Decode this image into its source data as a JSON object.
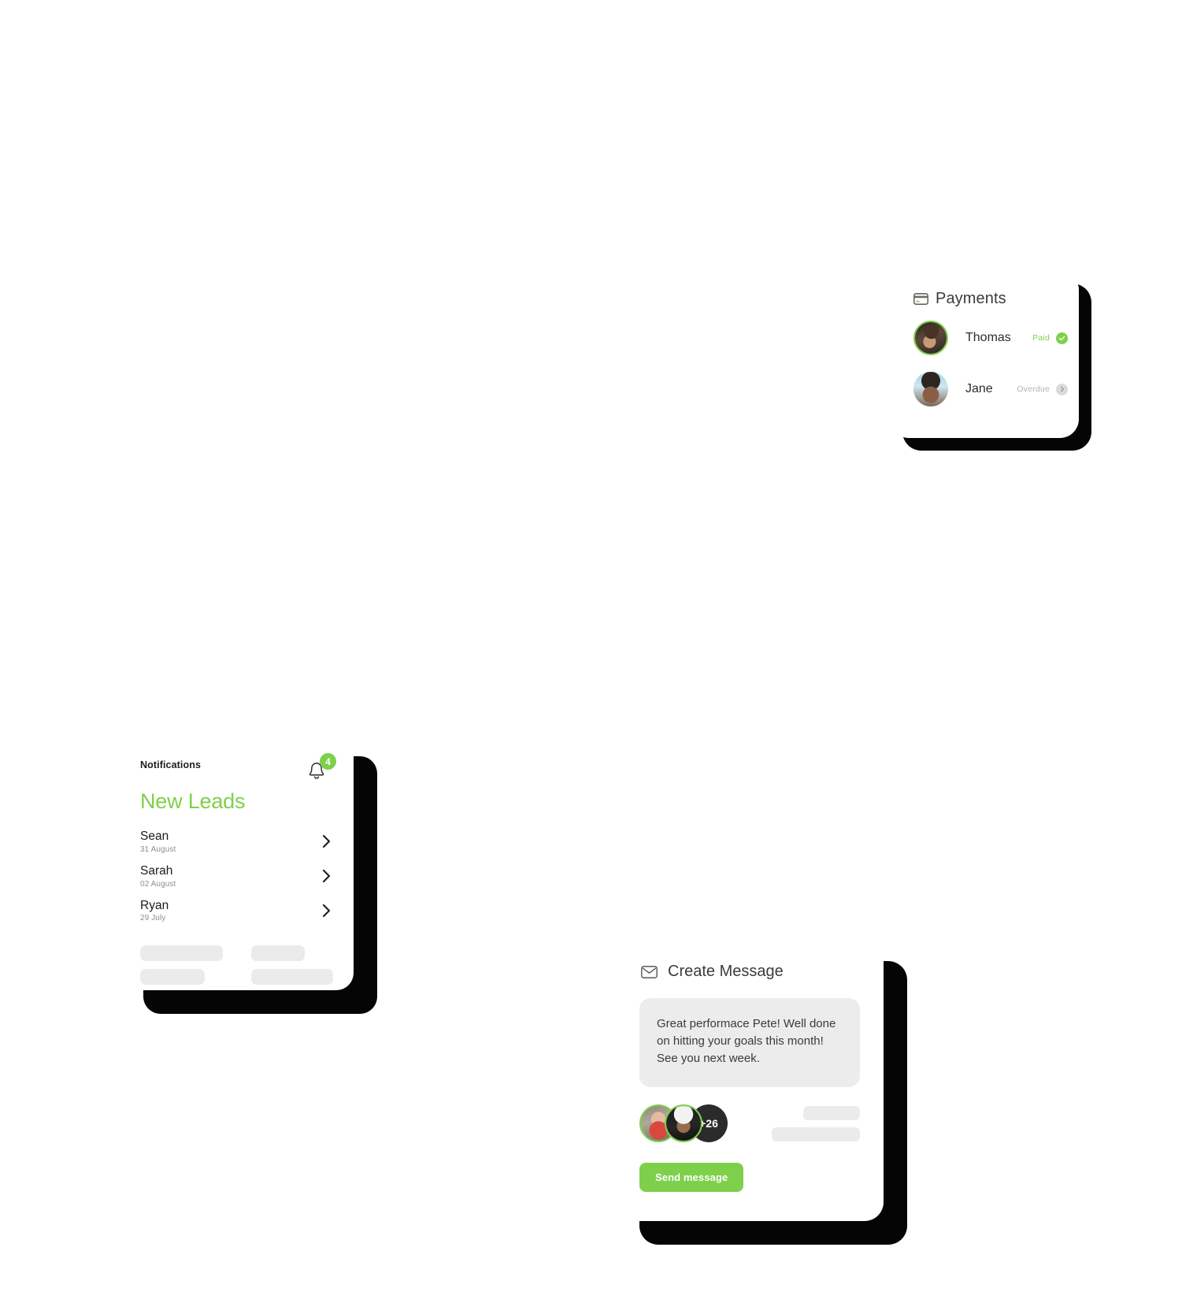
{
  "payments_card": {
    "title": "Payments",
    "icon": "credit-card-icon",
    "rows": [
      {
        "name": "Thomas",
        "status": "Paid",
        "status_color": "#7ED04B",
        "badge_icon": "check-circle-icon",
        "avatar": "thomas-avatar"
      },
      {
        "name": "Jane",
        "status": "Overdue",
        "status_color": "#B4B4B4",
        "badge_icon": "chevron-right-circle-icon",
        "avatar": "jane-avatar"
      }
    ]
  },
  "notifications_card": {
    "label": "Notifications",
    "badge_count": "4",
    "bell_icon": "bell-icon",
    "title": "New Leads",
    "title_color": "#7ED04B",
    "leads": [
      {
        "name": "Sean",
        "date": "31 August"
      },
      {
        "name": "Sarah",
        "date": "02 August"
      },
      {
        "name": "Ryan",
        "date": "29 July"
      }
    ],
    "chevron_icon": "chevron-right-icon",
    "skeleton_placeholder_count": 4
  },
  "create_message_card": {
    "title": "Create Message",
    "icon": "envelope-icon",
    "message_body": "Great performace Pete! Well done on hitting your goals this month! See you next week.",
    "recipients": {
      "avatars": [
        "woman-avatar",
        "man-cap-avatar"
      ],
      "overflow_label": "+26"
    },
    "send_button_label": "Send message",
    "send_button_color": "#7ED04B",
    "skeleton_placeholder_count": 2
  },
  "theme": {
    "accent_green": "#7ED04B",
    "shadow_black": "#050505",
    "skeleton_grey": "#EBEBEB",
    "bubble_grey": "#ECECEC",
    "background": "#FFFFFF"
  }
}
